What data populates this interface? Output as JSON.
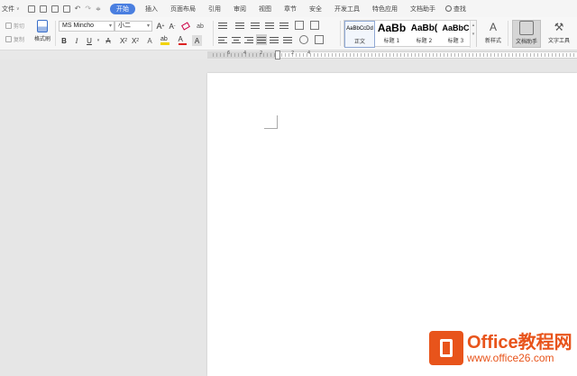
{
  "menubar": {
    "file_label": "文件",
    "tabs": [
      {
        "label": "开始",
        "active": true
      },
      {
        "label": "插入"
      },
      {
        "label": "页面布局"
      },
      {
        "label": "引用"
      },
      {
        "label": "审阅"
      },
      {
        "label": "视图"
      },
      {
        "label": "章节"
      },
      {
        "label": "安全"
      },
      {
        "label": "开发工具"
      },
      {
        "label": "特色应用"
      },
      {
        "label": "文档助手"
      }
    ],
    "search_label": "查找"
  },
  "ribbon": {
    "cut_label": "剪切",
    "copy_label": "复制",
    "format_painter_label": "格式刷",
    "font_name": "MS Mincho",
    "font_size": "小二",
    "bold": "B",
    "italic": "I",
    "underline": "U",
    "styles": [
      {
        "sample": "AaBbCcDd",
        "label": "正文"
      },
      {
        "sample": "AaBb",
        "label": "标题 1"
      },
      {
        "sample": "AaBb(",
        "label": "标题 2"
      },
      {
        "sample": "AaBbC",
        "label": "标题 3"
      }
    ],
    "new_style_label": "新样式",
    "doc_assistant_label": "文档助手",
    "text_tools_label": "文字工具"
  },
  "ruler": {
    "numbers": [
      "6",
      "4",
      "2",
      "2",
      "4"
    ]
  },
  "watermark": {
    "brand": "Office教程网",
    "url": "www.office26.com"
  },
  "colors": {
    "accent": "#4a7fe0",
    "brand": "#e8541b"
  }
}
